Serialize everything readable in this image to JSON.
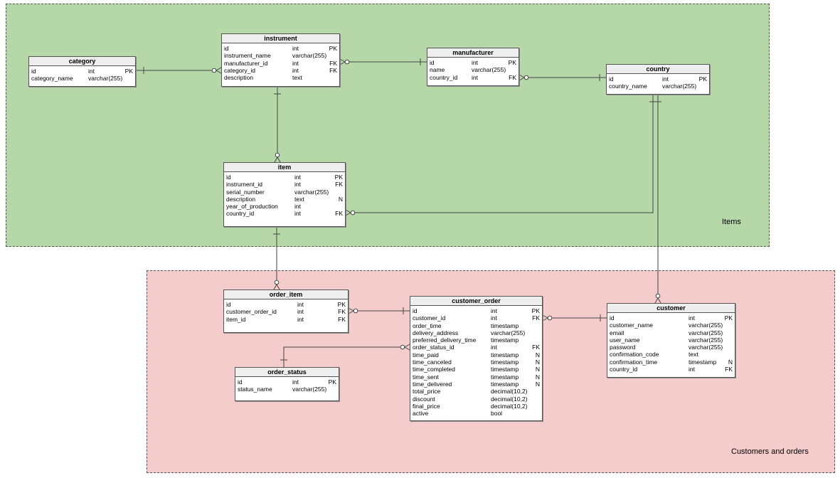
{
  "areas": {
    "items": {
      "label": "Items",
      "color": "#b6d7a8"
    },
    "orders": {
      "label": "Customers and orders",
      "color": "#f4cccc"
    }
  },
  "entities": {
    "category": {
      "name": "category",
      "columns": [
        [
          "id",
          "int",
          "PK"
        ],
        [
          "category_name",
          "varchar(255)",
          ""
        ]
      ]
    },
    "instrument": {
      "name": "instrument",
      "columns": [
        [
          "id",
          "int",
          "PK"
        ],
        [
          "instrument_name",
          "varchar(255)",
          ""
        ],
        [
          "manufacturer_id",
          "int",
          "FK"
        ],
        [
          "category_id",
          "int",
          "FK"
        ],
        [
          "description",
          "text",
          ""
        ]
      ]
    },
    "manufacturer": {
      "name": "manufacturer",
      "columns": [
        [
          "id",
          "int",
          "PK"
        ],
        [
          "name",
          "varchar(255)",
          ""
        ],
        [
          "country_id",
          "int",
          "FK"
        ]
      ]
    },
    "country": {
      "name": "country",
      "columns": [
        [
          "id",
          "int",
          "PK"
        ],
        [
          "country_name",
          "varchar(255)",
          ""
        ]
      ]
    },
    "item": {
      "name": "item",
      "columns": [
        [
          "id",
          "int",
          "PK"
        ],
        [
          "instrument_id",
          "int",
          "FK"
        ],
        [
          "serial_number",
          "varchar(255)",
          ""
        ],
        [
          "description",
          "text",
          "N"
        ],
        [
          "year_of_production",
          "int",
          ""
        ],
        [
          "country_id",
          "int",
          "FK"
        ]
      ]
    },
    "order_item": {
      "name": "order_item",
      "columns": [
        [
          "id",
          "int",
          "PK"
        ],
        [
          "customer_order_id",
          "int",
          "FK"
        ],
        [
          "item_id",
          "int",
          "FK"
        ]
      ]
    },
    "customer_order": {
      "name": "customer_order",
      "columns": [
        [
          "id",
          "int",
          "PK"
        ],
        [
          "customer_id",
          "int",
          "FK"
        ],
        [
          "order_time",
          "timestamp",
          ""
        ],
        [
          "delivery_address",
          "varchar(255)",
          ""
        ],
        [
          "preferred_delivery_time",
          "timestamp",
          ""
        ],
        [
          "order_status_id",
          "int",
          "FK"
        ],
        [
          "time_paid",
          "timestamp",
          "N"
        ],
        [
          "time_canceled",
          "timestamp",
          "N"
        ],
        [
          "time_completed",
          "timestamp",
          "N"
        ],
        [
          "time_sent",
          "timestamp",
          "N"
        ],
        [
          "time_delivered",
          "timestamp",
          "N"
        ],
        [
          "total_price",
          "decimal(10,2)",
          ""
        ],
        [
          "discount",
          "decimal(10,2)",
          ""
        ],
        [
          "final_price",
          "decimal(10,2)",
          ""
        ],
        [
          "active",
          "bool",
          ""
        ]
      ]
    },
    "order_status": {
      "name": "order_status",
      "columns": [
        [
          "id",
          "int",
          "PK"
        ],
        [
          "status_name",
          "varchar(255)",
          ""
        ]
      ]
    },
    "customer": {
      "name": "customer",
      "columns": [
        [
          "id",
          "int",
          "PK"
        ],
        [
          "customer_name",
          "varchar(255)",
          ""
        ],
        [
          "email",
          "varchar(255)",
          ""
        ],
        [
          "user_name",
          "varchar(255)",
          ""
        ],
        [
          "password",
          "varchar(255)",
          ""
        ],
        [
          "confirmation_code",
          "text",
          ""
        ],
        [
          "confirmation_time",
          "timestamp",
          "N"
        ],
        [
          "country_id",
          "int",
          "FK"
        ]
      ]
    }
  },
  "relationships": [
    {
      "from": "instrument.category_id",
      "to": "category.id",
      "type": "many-to-one"
    },
    {
      "from": "instrument.manufacturer_id",
      "to": "manufacturer.id",
      "type": "many-to-one"
    },
    {
      "from": "manufacturer.country_id",
      "to": "country.id",
      "type": "many-to-one"
    },
    {
      "from": "item.instrument_id",
      "to": "instrument.id",
      "type": "many-to-one"
    },
    {
      "from": "item.country_id",
      "to": "country.id",
      "type": "many-to-one"
    },
    {
      "from": "order_item.item_id",
      "to": "item.id",
      "type": "many-to-one"
    },
    {
      "from": "order_item.customer_order_id",
      "to": "customer_order.id",
      "type": "many-to-one"
    },
    {
      "from": "customer_order.order_status_id",
      "to": "order_status.id",
      "type": "many-to-one"
    },
    {
      "from": "customer_order.customer_id",
      "to": "customer.id",
      "type": "many-to-one"
    },
    {
      "from": "customer.country_id",
      "to": "country.id",
      "type": "many-to-one"
    }
  ]
}
